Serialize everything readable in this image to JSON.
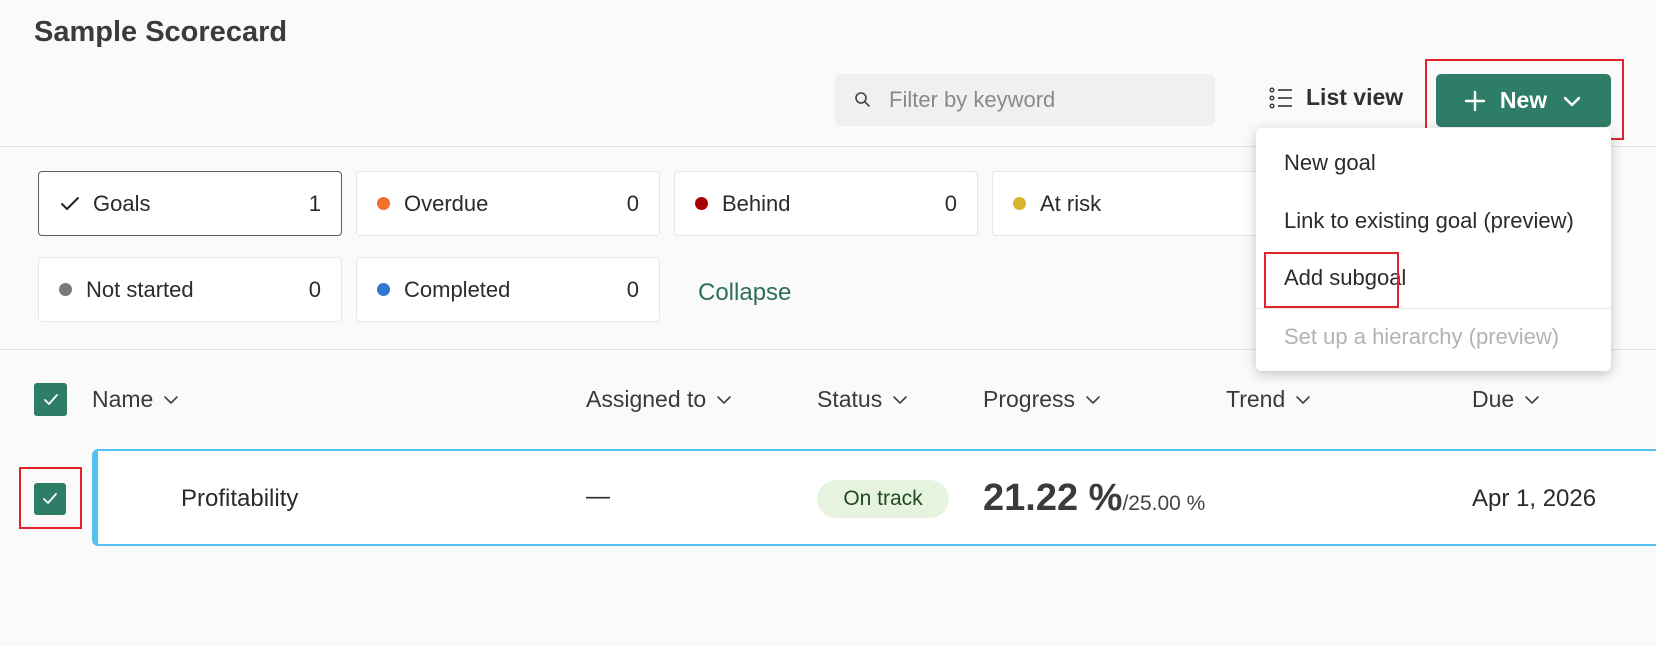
{
  "page": {
    "title": "Sample Scorecard"
  },
  "toolbar": {
    "search_placeholder": "Filter by keyword",
    "list_view_label": "List view",
    "new_label": "New"
  },
  "status_cards": [
    {
      "label": "Goals",
      "count": "1",
      "color": ""
    },
    {
      "label": "Overdue",
      "count": "0",
      "color": "#f0702a"
    },
    {
      "label": "Behind",
      "count": "0",
      "color": "#a80000"
    },
    {
      "label": "At risk",
      "count": "",
      "color": "#d7b32e"
    },
    {
      "label": "Not started",
      "count": "0",
      "color": "#7a7a7a"
    },
    {
      "label": "Completed",
      "count": "0",
      "color": "#2f78d1"
    }
  ],
  "collapse_label": "Collapse",
  "new_menu": {
    "items": [
      {
        "label": "New goal",
        "disabled": false
      },
      {
        "label": "Link to existing goal (preview)",
        "disabled": false
      },
      {
        "label": "Add subgoal",
        "disabled": false
      },
      {
        "label": "Set up a hierarchy (preview)",
        "disabled": true
      }
    ]
  },
  "table": {
    "columns": [
      "Name",
      "Assigned to",
      "Status",
      "Progress",
      "Trend",
      "Due"
    ],
    "rows": [
      {
        "name": "Profitability",
        "assigned_to": "—",
        "status": "On track",
        "progress_value": "21.22 %",
        "progress_target": "/25.00 %",
        "trend": "",
        "due": "Apr 1, 2026"
      }
    ]
  },
  "colors": {
    "accent": "#2e7d66",
    "highlight": "#e3232a",
    "row_border": "#55c1ee",
    "on_track_bg": "#e6f4df"
  }
}
